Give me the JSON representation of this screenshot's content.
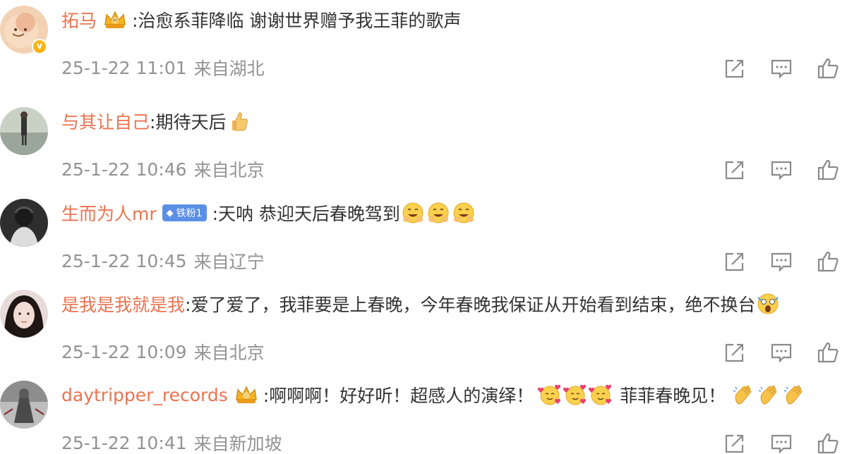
{
  "comments": [
    {
      "username": "拓马",
      "badge": "crown",
      "text": ":治愈系菲降临 谢谢世界赠予我王菲的歌声",
      "time": "25-1-22 11:01",
      "location": "来自湖北",
      "verified": true,
      "avatar_color": "#f0c9a8"
    },
    {
      "username": "与其让自己",
      "text": ":期待天后",
      "emoji_after": "thumbs-up",
      "time": "25-1-22 10:46",
      "location": "来自北京",
      "avatar_color": "#9aa6a0"
    },
    {
      "username": "生而为人mr",
      "fan_badge": "铁粉1",
      "text": ":天呐 恭迎天后春晚驾到",
      "emoji_after": "grin-hands x3",
      "time": "25-1-22 10:45",
      "location": "来自辽宁",
      "avatar_color": "#3c3c3c"
    },
    {
      "username": "是我是我就是我",
      "text": ":爱了爱了，我菲要是上春晚，今年春晚我保证从开始看到结束，绝不换台",
      "emoji_after": "shocked",
      "time": "25-1-22 10:09",
      "location": "来自北京",
      "avatar_color": "#d9c3c0"
    },
    {
      "username": "daytripper_records",
      "badge": "crown",
      "text_a": ":啊啊啊！好好听！超感人的演绎！",
      "text_b": "菲菲春晚见！",
      "emoji_mid": "hearts-face x3",
      "emoji_end": "clap x3",
      "time": "25-1-22 10:41",
      "location": "来自新加坡",
      "avatar_color": "#6d6d6d"
    }
  ],
  "colors": {
    "username": "#eb7350",
    "meta": "#939393",
    "fan_badge": "#5b8fe6",
    "icon": "#8a8a8a"
  },
  "icons": [
    "share-icon",
    "comment-icon",
    "like-icon"
  ]
}
